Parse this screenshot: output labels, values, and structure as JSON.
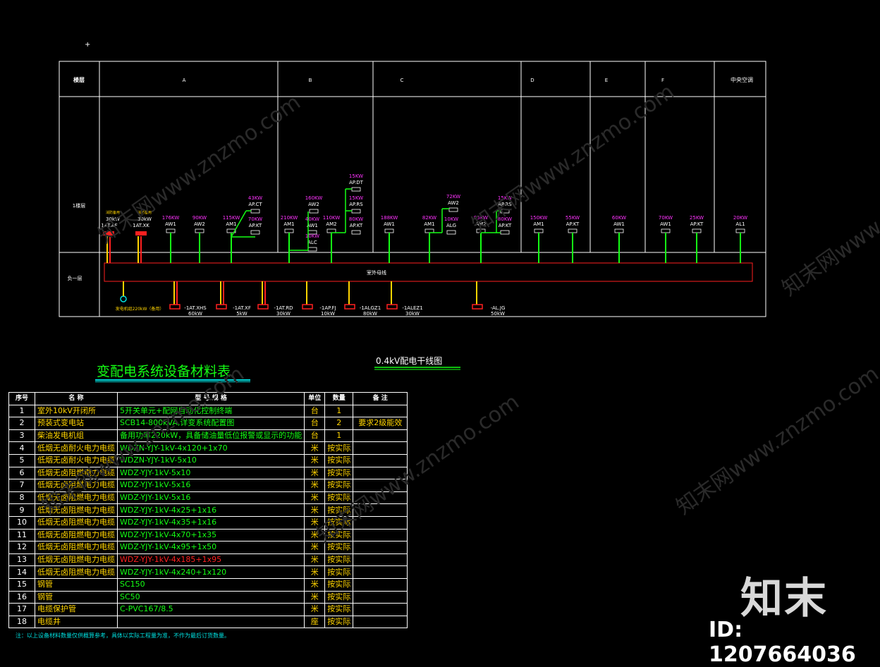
{
  "riser": {
    "header_first": "楼层",
    "zones": [
      "A",
      "B",
      "C",
      "D",
      "E",
      "F",
      "中央空调"
    ],
    "row_floor1_label": "1楼层",
    "row_b1_label": "负一层",
    "busbar_label": "室外母线",
    "loads": [
      {
        "kw": "30kW",
        "name": "1AT.AF",
        "note": "消防备用"
      },
      {
        "kw": "30kW",
        "name": "1AT.XK",
        "note": "消防备用"
      },
      {
        "kw": "176KW",
        "name": "AW1"
      },
      {
        "kw": "90KW",
        "name": "AW2"
      },
      {
        "kw": "115KW",
        "name": "AM1"
      },
      {
        "kw": "43KW",
        "name": "AP.CT"
      },
      {
        "kw": "70KW",
        "name": "AP.KT"
      },
      {
        "kw": "210KW",
        "name": "AM1"
      },
      {
        "kw": "160KW",
        "name": "AW2"
      },
      {
        "kw": "40KW",
        "name": "AW1"
      },
      {
        "kw": "10KW",
        "name": "ALC"
      },
      {
        "kw": "110KW",
        "name": "AM2"
      },
      {
        "kw": "15KW",
        "name": "AP.DT"
      },
      {
        "kw": "15KW",
        "name": "AP.RS"
      },
      {
        "kw": "80KW",
        "name": "AP.KT"
      },
      {
        "kw": "188KW",
        "name": "AW1"
      },
      {
        "kw": "82KW",
        "name": "AM1"
      },
      {
        "kw": "72KW",
        "name": "AW2"
      },
      {
        "kw": "10KW",
        "name": "ALG"
      },
      {
        "kw": "95KW",
        "name": "AM2"
      },
      {
        "kw": "15KW",
        "name": "AP.RS"
      },
      {
        "kw": "80KW",
        "name": "AP.KT"
      },
      {
        "kw": "150KW",
        "name": "AM1"
      },
      {
        "kw": "55KW",
        "name": "AP.KT"
      },
      {
        "kw": "60KW",
        "name": "AW1"
      },
      {
        "kw": "70KW",
        "name": "AW1"
      },
      {
        "kw": "25KW",
        "name": "AP.KT"
      },
      {
        "kw": "20KW",
        "name": "AL1"
      }
    ],
    "generator": "发电机组220kW（备用）",
    "b1_loads": [
      {
        "name": "1AT.XHS",
        "kw": "60kW"
      },
      {
        "name": "1AT.XF",
        "kw": "5kW"
      },
      {
        "name": "1AT.RD",
        "kw": "30kW"
      },
      {
        "name": "1AP.FJ",
        "kw": "10kW"
      },
      {
        "name": "1ALGZ1",
        "kw": "80kW"
      },
      {
        "name": "1ALEZ1",
        "kw": "30kW"
      },
      {
        "name": "AL.JG",
        "kw": "50kW"
      }
    ],
    "title": "0.4kV配电干线图"
  },
  "bom": {
    "title": "变配电系统设备材料表",
    "headers": [
      "序号",
      "名 称",
      "型 号 规 格",
      "单位",
      "数量",
      "备 注"
    ],
    "rows": [
      [
        "1",
        "室外10kV开闭所",
        "5开关单元+配网自动化控制终端",
        "台",
        "1",
        ""
      ],
      [
        "2",
        "预装式变电站",
        "SCB14-800kVA,详变系统配置图",
        "台",
        "2",
        "要求2级能效"
      ],
      [
        "3",
        "柴油发电机组",
        "备用功率220kW，具备储油量低位报警或显示的功能",
        "台",
        "1",
        ""
      ],
      [
        "4",
        "低烟无卤耐火电力电缆",
        "WDZN-YJY-1kV-4x120+1x70",
        "米",
        "按实际",
        ""
      ],
      [
        "5",
        "低烟无卤耐火电力电缆",
        "WDZN-YJY-1kV-5x10",
        "米",
        "按实际",
        ""
      ],
      [
        "6",
        "低烟无卤阻燃电力电缆",
        "WDZ-YJY-1kV-5x10",
        "米",
        "按实际",
        ""
      ],
      [
        "7",
        "低烟无卤阻燃电力电缆",
        "WDZ-YJY-1kV-5x16",
        "米",
        "按实际",
        ""
      ],
      [
        "8",
        "低烟无卤阻燃电力电缆",
        "WDZ-YJY-1kV-5x16",
        "米",
        "按实际",
        ""
      ],
      [
        "9",
        "低烟无卤阻燃电力电缆",
        "WDZ-YJY-1kV-4x25+1x16",
        "米",
        "按实际",
        ""
      ],
      [
        "10",
        "低烟无卤阻燃电力电缆",
        "WDZ-YJY-1kV-4x35+1x16",
        "米",
        "按实际",
        ""
      ],
      [
        "11",
        "低烟无卤阻燃电力电缆",
        "WDZ-YJY-1kV-4x70+1x35",
        "米",
        "按实际",
        ""
      ],
      [
        "12",
        "低烟无卤阻燃电力电缆",
        "WDZ-YJY-1kV-4x95+1x50",
        "米",
        "按实际",
        ""
      ],
      [
        "13",
        "低烟无卤阻燃电力电缆",
        "WDZ-YJY-1kV-4x185+1x95",
        "米",
        "按实际",
        ""
      ],
      [
        "14",
        "低烟无卤阻燃电力电缆",
        "WDZ-YJY-1kV-4x240+1x120",
        "米",
        "按实际",
        ""
      ],
      [
        "15",
        "钢管",
        "SC150",
        "米",
        "按实际",
        ""
      ],
      [
        "16",
        "钢管",
        "SC50",
        "米",
        "按实际",
        ""
      ],
      [
        "17",
        "电缆保护管",
        "C-PVC167/8.5",
        "米",
        "按实际",
        ""
      ],
      [
        "18",
        "电缆井",
        "",
        "座",
        "按实际",
        ""
      ]
    ],
    "note": "注：以上设备材料数量仅供概算参考，具体以实际工程量为准，不作为最后订货数量。"
  },
  "watermark": {
    "logo": "知末",
    "id": "ID: 1207664036",
    "text": "知末网www.znzmo.com"
  }
}
